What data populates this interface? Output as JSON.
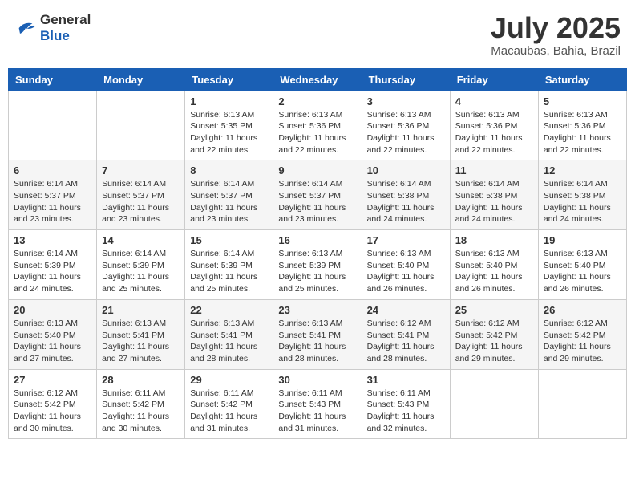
{
  "header": {
    "logo_general": "General",
    "logo_blue": "Blue",
    "month_year": "July 2025",
    "location": "Macaubas, Bahia, Brazil"
  },
  "weekdays": [
    "Sunday",
    "Monday",
    "Tuesday",
    "Wednesday",
    "Thursday",
    "Friday",
    "Saturday"
  ],
  "weeks": [
    [
      {
        "day": "",
        "info": ""
      },
      {
        "day": "",
        "info": ""
      },
      {
        "day": "1",
        "info": "Sunrise: 6:13 AM\nSunset: 5:35 PM\nDaylight: 11 hours and 22 minutes."
      },
      {
        "day": "2",
        "info": "Sunrise: 6:13 AM\nSunset: 5:36 PM\nDaylight: 11 hours and 22 minutes."
      },
      {
        "day": "3",
        "info": "Sunrise: 6:13 AM\nSunset: 5:36 PM\nDaylight: 11 hours and 22 minutes."
      },
      {
        "day": "4",
        "info": "Sunrise: 6:13 AM\nSunset: 5:36 PM\nDaylight: 11 hours and 22 minutes."
      },
      {
        "day": "5",
        "info": "Sunrise: 6:13 AM\nSunset: 5:36 PM\nDaylight: 11 hours and 22 minutes."
      }
    ],
    [
      {
        "day": "6",
        "info": "Sunrise: 6:14 AM\nSunset: 5:37 PM\nDaylight: 11 hours and 23 minutes."
      },
      {
        "day": "7",
        "info": "Sunrise: 6:14 AM\nSunset: 5:37 PM\nDaylight: 11 hours and 23 minutes."
      },
      {
        "day": "8",
        "info": "Sunrise: 6:14 AM\nSunset: 5:37 PM\nDaylight: 11 hours and 23 minutes."
      },
      {
        "day": "9",
        "info": "Sunrise: 6:14 AM\nSunset: 5:37 PM\nDaylight: 11 hours and 23 minutes."
      },
      {
        "day": "10",
        "info": "Sunrise: 6:14 AM\nSunset: 5:38 PM\nDaylight: 11 hours and 24 minutes."
      },
      {
        "day": "11",
        "info": "Sunrise: 6:14 AM\nSunset: 5:38 PM\nDaylight: 11 hours and 24 minutes."
      },
      {
        "day": "12",
        "info": "Sunrise: 6:14 AM\nSunset: 5:38 PM\nDaylight: 11 hours and 24 minutes."
      }
    ],
    [
      {
        "day": "13",
        "info": "Sunrise: 6:14 AM\nSunset: 5:39 PM\nDaylight: 11 hours and 24 minutes."
      },
      {
        "day": "14",
        "info": "Sunrise: 6:14 AM\nSunset: 5:39 PM\nDaylight: 11 hours and 25 minutes."
      },
      {
        "day": "15",
        "info": "Sunrise: 6:14 AM\nSunset: 5:39 PM\nDaylight: 11 hours and 25 minutes."
      },
      {
        "day": "16",
        "info": "Sunrise: 6:13 AM\nSunset: 5:39 PM\nDaylight: 11 hours and 25 minutes."
      },
      {
        "day": "17",
        "info": "Sunrise: 6:13 AM\nSunset: 5:40 PM\nDaylight: 11 hours and 26 minutes."
      },
      {
        "day": "18",
        "info": "Sunrise: 6:13 AM\nSunset: 5:40 PM\nDaylight: 11 hours and 26 minutes."
      },
      {
        "day": "19",
        "info": "Sunrise: 6:13 AM\nSunset: 5:40 PM\nDaylight: 11 hours and 26 minutes."
      }
    ],
    [
      {
        "day": "20",
        "info": "Sunrise: 6:13 AM\nSunset: 5:40 PM\nDaylight: 11 hours and 27 minutes."
      },
      {
        "day": "21",
        "info": "Sunrise: 6:13 AM\nSunset: 5:41 PM\nDaylight: 11 hours and 27 minutes."
      },
      {
        "day": "22",
        "info": "Sunrise: 6:13 AM\nSunset: 5:41 PM\nDaylight: 11 hours and 28 minutes."
      },
      {
        "day": "23",
        "info": "Sunrise: 6:13 AM\nSunset: 5:41 PM\nDaylight: 11 hours and 28 minutes."
      },
      {
        "day": "24",
        "info": "Sunrise: 6:12 AM\nSunset: 5:41 PM\nDaylight: 11 hours and 28 minutes."
      },
      {
        "day": "25",
        "info": "Sunrise: 6:12 AM\nSunset: 5:42 PM\nDaylight: 11 hours and 29 minutes."
      },
      {
        "day": "26",
        "info": "Sunrise: 6:12 AM\nSunset: 5:42 PM\nDaylight: 11 hours and 29 minutes."
      }
    ],
    [
      {
        "day": "27",
        "info": "Sunrise: 6:12 AM\nSunset: 5:42 PM\nDaylight: 11 hours and 30 minutes."
      },
      {
        "day": "28",
        "info": "Sunrise: 6:11 AM\nSunset: 5:42 PM\nDaylight: 11 hours and 30 minutes."
      },
      {
        "day": "29",
        "info": "Sunrise: 6:11 AM\nSunset: 5:42 PM\nDaylight: 11 hours and 31 minutes."
      },
      {
        "day": "30",
        "info": "Sunrise: 6:11 AM\nSunset: 5:43 PM\nDaylight: 11 hours and 31 minutes."
      },
      {
        "day": "31",
        "info": "Sunrise: 6:11 AM\nSunset: 5:43 PM\nDaylight: 11 hours and 32 minutes."
      },
      {
        "day": "",
        "info": ""
      },
      {
        "day": "",
        "info": ""
      }
    ]
  ]
}
